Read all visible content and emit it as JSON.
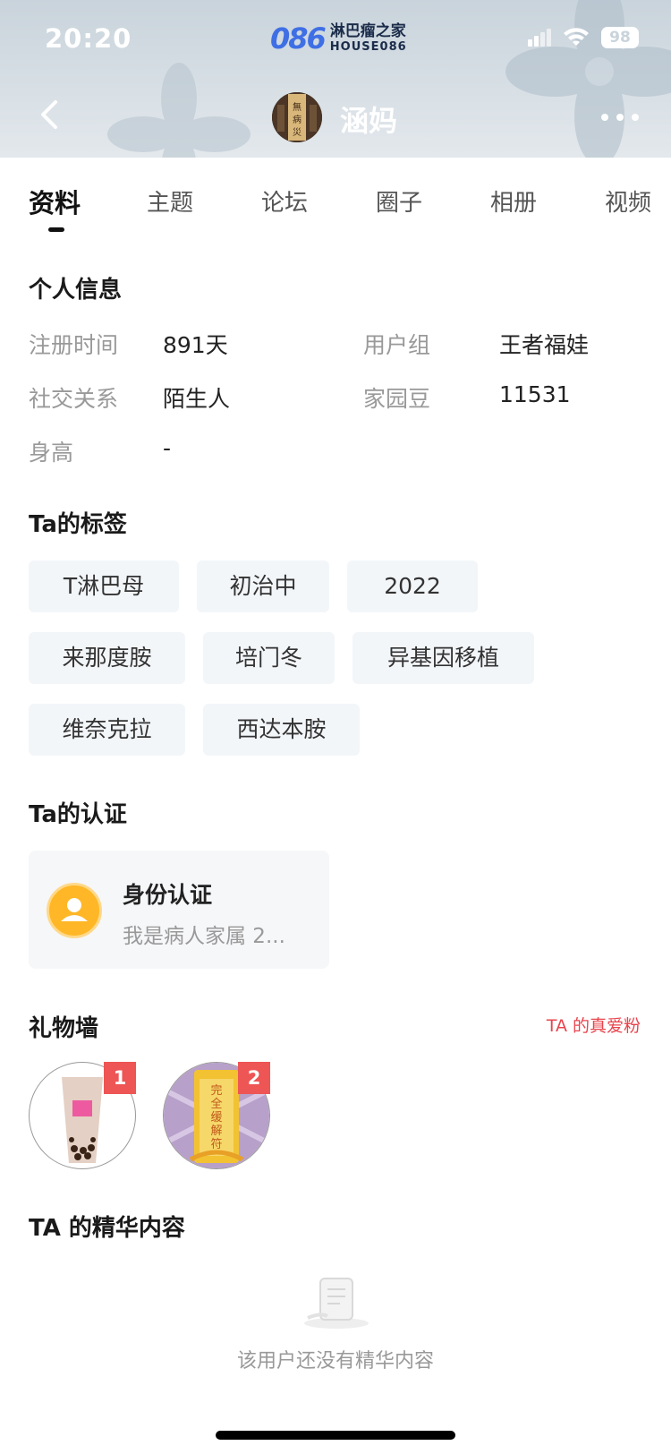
{
  "status_bar": {
    "time": "20:20",
    "battery": "98"
  },
  "logo": {
    "mark": "086",
    "name_cn": "淋巴瘤之家",
    "name_en": "HOUSE086"
  },
  "profile": {
    "nickname": "涵妈",
    "avatar_text": "無病無災"
  },
  "tabs": [
    {
      "label": "资料",
      "active": true
    },
    {
      "label": "主题"
    },
    {
      "label": "论坛"
    },
    {
      "label": "圈子"
    },
    {
      "label": "相册"
    },
    {
      "label": "视频"
    }
  ],
  "personal_info": {
    "title": "个人信息",
    "reg_label": "注册时间",
    "reg_value": "891天",
    "group_label": "用户组",
    "group_value": "王者福娃",
    "social_label": "社交关系",
    "social_value": "陌生人",
    "beans_label": "家园豆",
    "beans_value": "11531",
    "height_label": "身高",
    "height_value": "-"
  },
  "tags": {
    "title": "Ta的标签",
    "items": [
      "T淋巴母",
      "初治中",
      "2022",
      "来那度胺",
      "培门冬",
      "异基因移植",
      "维奈克拉",
      "西达本胺"
    ]
  },
  "certification": {
    "title": "Ta的认证",
    "card_title": "身份认证",
    "card_desc": "我是病人家属 2..."
  },
  "gift_wall": {
    "title": "礼物墙",
    "link": "TA 的真爱粉",
    "gifts": [
      {
        "rank": "1",
        "name": "milk-tea"
      },
      {
        "rank": "2",
        "name": "amulet",
        "text": "完全缓解符"
      }
    ]
  },
  "featured": {
    "title": "TA 的精华内容",
    "empty": "该用户还没有精华内容"
  },
  "colors": {
    "accent_red": "#e8444d",
    "badge_red": "#ee5555",
    "cert_yellow": "#ffb727"
  }
}
